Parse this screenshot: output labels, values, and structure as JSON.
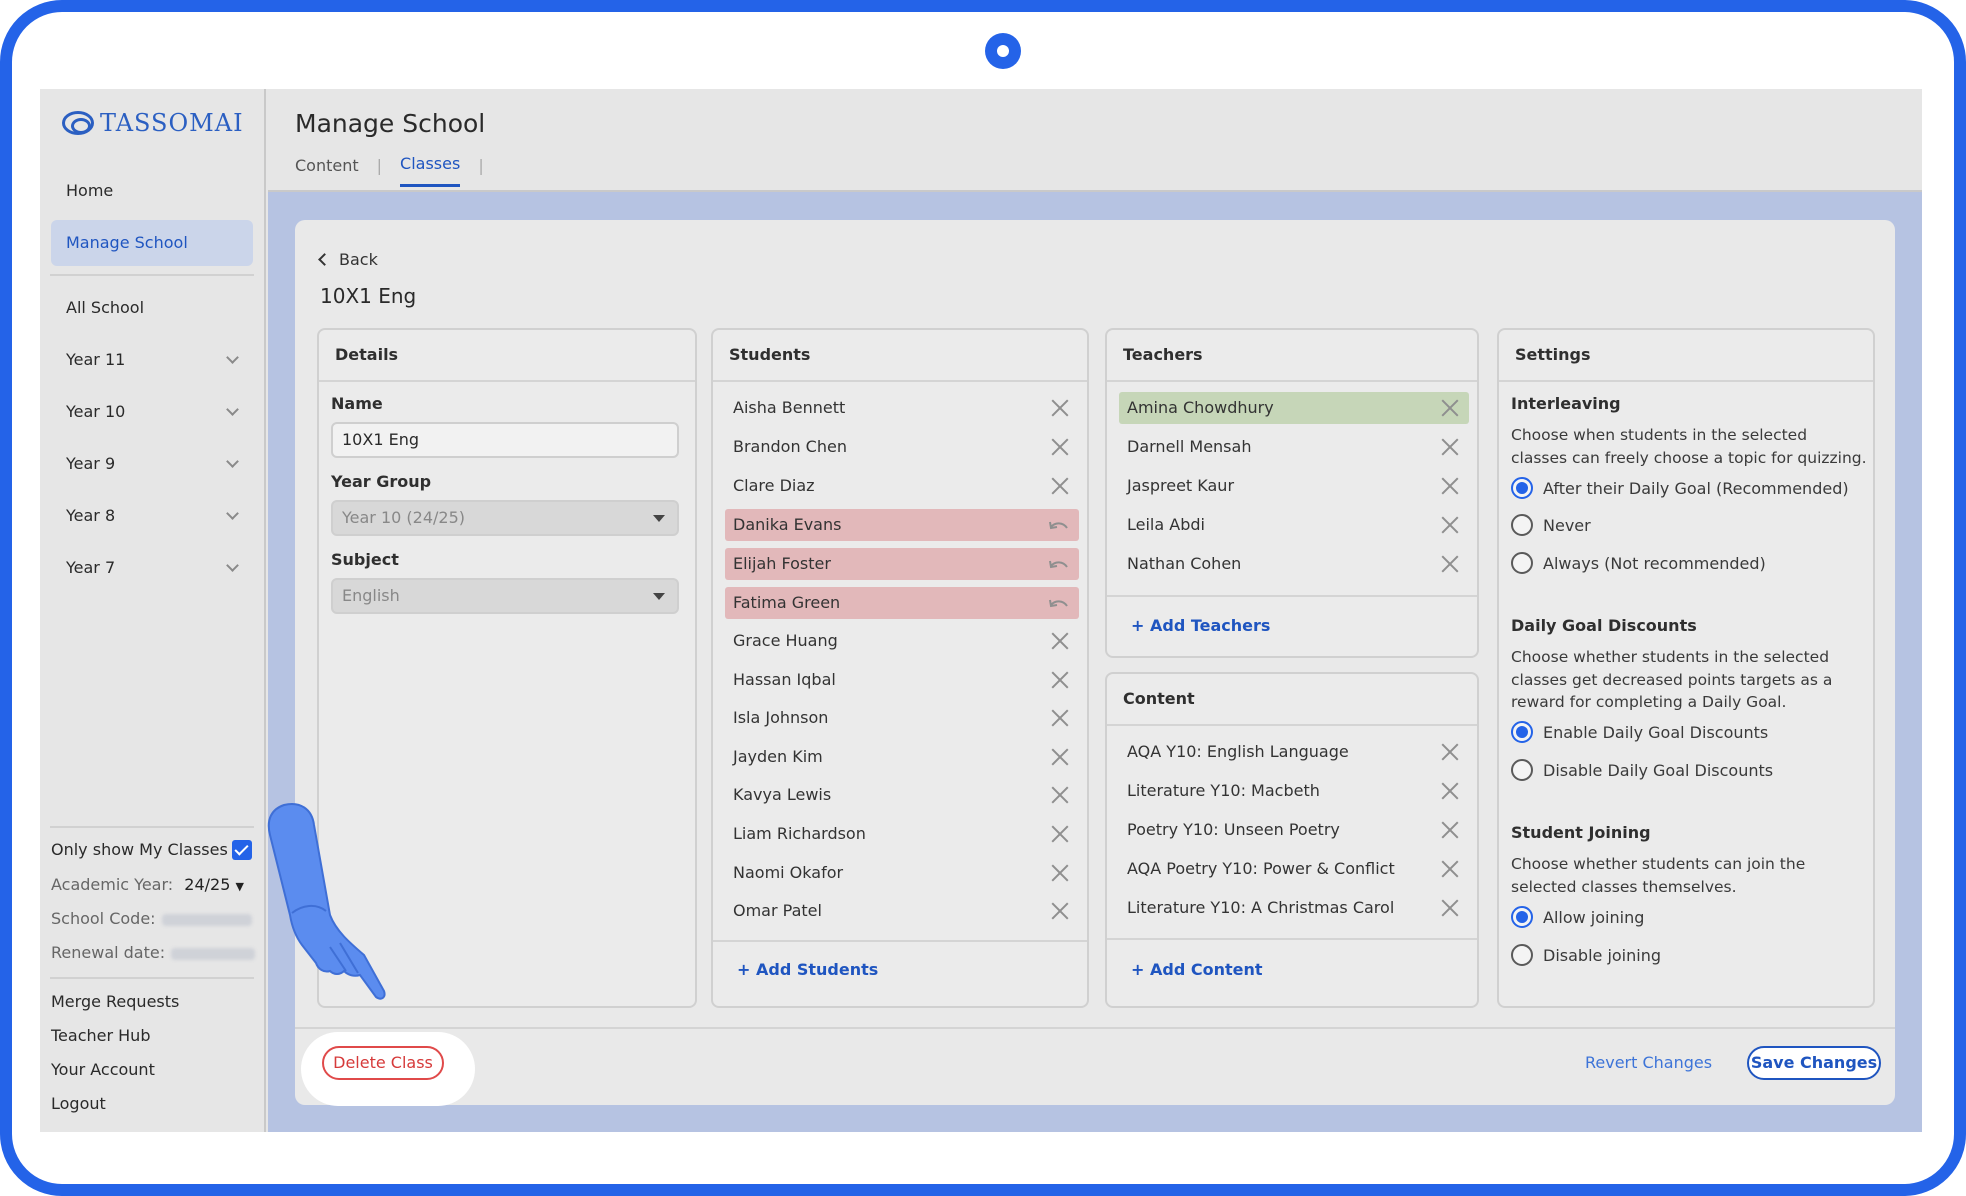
{
  "brand": {
    "logo_text": "TASSOMAI",
    "accent": "#2463e8"
  },
  "sidebar": {
    "items": [
      {
        "label": "Home"
      },
      {
        "label": "Manage School"
      },
      {
        "label": "All School"
      },
      {
        "label": "Year 11"
      },
      {
        "label": "Year 10"
      },
      {
        "label": "Year 9"
      },
      {
        "label": "Year 8"
      },
      {
        "label": "Year 7"
      }
    ],
    "only_my_classes": "Only show My Classes",
    "academic_year_label": "Academic Year:",
    "academic_year_value": "24/25",
    "school_code_label": "School Code:",
    "renewal_label": "Renewal date:",
    "links": [
      {
        "label": "Merge Requests"
      },
      {
        "label": "Teacher Hub"
      },
      {
        "label": "Your Account"
      },
      {
        "label": "Logout"
      }
    ]
  },
  "header": {
    "title": "Manage School",
    "tabs": [
      {
        "label": "Content"
      },
      {
        "label": "Classes"
      }
    ]
  },
  "classview": {
    "back": "Back",
    "title": "10X1 Eng"
  },
  "details": {
    "heading": "Details",
    "name_label": "Name",
    "name_value": "10X1 Eng",
    "year_label": "Year Group",
    "year_value": "Year 10 (24/25)",
    "subject_label": "Subject",
    "subject_value": "English"
  },
  "students": {
    "heading": "Students",
    "items": [
      {
        "name": "Aisha Bennett"
      },
      {
        "name": "Brandon Chen"
      },
      {
        "name": "Clare Diaz"
      },
      {
        "name": "Danika Evans"
      },
      {
        "name": "Elijah Foster"
      },
      {
        "name": "Fatima Green"
      },
      {
        "name": "Grace Huang"
      },
      {
        "name": "Hassan Iqbal"
      },
      {
        "name": "Isla Johnson"
      },
      {
        "name": "Jayden Kim"
      },
      {
        "name": "Kavya Lewis"
      },
      {
        "name": "Liam Richardson"
      },
      {
        "name": "Naomi Okafor"
      },
      {
        "name": "Omar Patel"
      }
    ],
    "add": "+ Add Students"
  },
  "teachers": {
    "heading": "Teachers",
    "items": [
      {
        "name": "Amina Chowdhury"
      },
      {
        "name": "Darnell Mensah"
      },
      {
        "name": "Jaspreet Kaur"
      },
      {
        "name": "Leila Abdi"
      },
      {
        "name": "Nathan Cohen"
      }
    ],
    "add": "+ Add Teachers"
  },
  "content": {
    "heading": "Content",
    "items": [
      {
        "name": "AQA Y10: English Language"
      },
      {
        "name": "Literature Y10: Macbeth"
      },
      {
        "name": "Poetry Y10: Unseen Poetry"
      },
      {
        "name": "AQA Poetry Y10: Power & Conflict"
      },
      {
        "name": "Literature Y10: A Christmas Carol"
      }
    ],
    "add": "+ Add Content"
  },
  "settings": {
    "heading": "Settings",
    "interleaving": {
      "title": "Interleaving",
      "desc": "Choose when students in the selected classes can freely choose a topic for quizzing.",
      "options": [
        {
          "label": "After their Daily Goal (Recommended)"
        },
        {
          "label": "Never"
        },
        {
          "label": "Always (Not recommended)"
        }
      ]
    },
    "discounts": {
      "title": "Daily Goal Discounts",
      "desc": "Choose whether students in the selected classes get decreased points targets as a reward for completing a Daily Goal.",
      "options": [
        {
          "label": "Enable Daily Goal Discounts"
        },
        {
          "label": "Disable Daily Goal Discounts"
        }
      ]
    },
    "joining": {
      "title": "Student Joining",
      "desc": "Choose whether students can join the selected classes themselves.",
      "options": [
        {
          "label": "Allow joining"
        },
        {
          "label": "Disable joining"
        }
      ]
    }
  },
  "footer": {
    "delete": "Delete Class",
    "revert": "Revert Changes",
    "save": "Save Changes"
  }
}
